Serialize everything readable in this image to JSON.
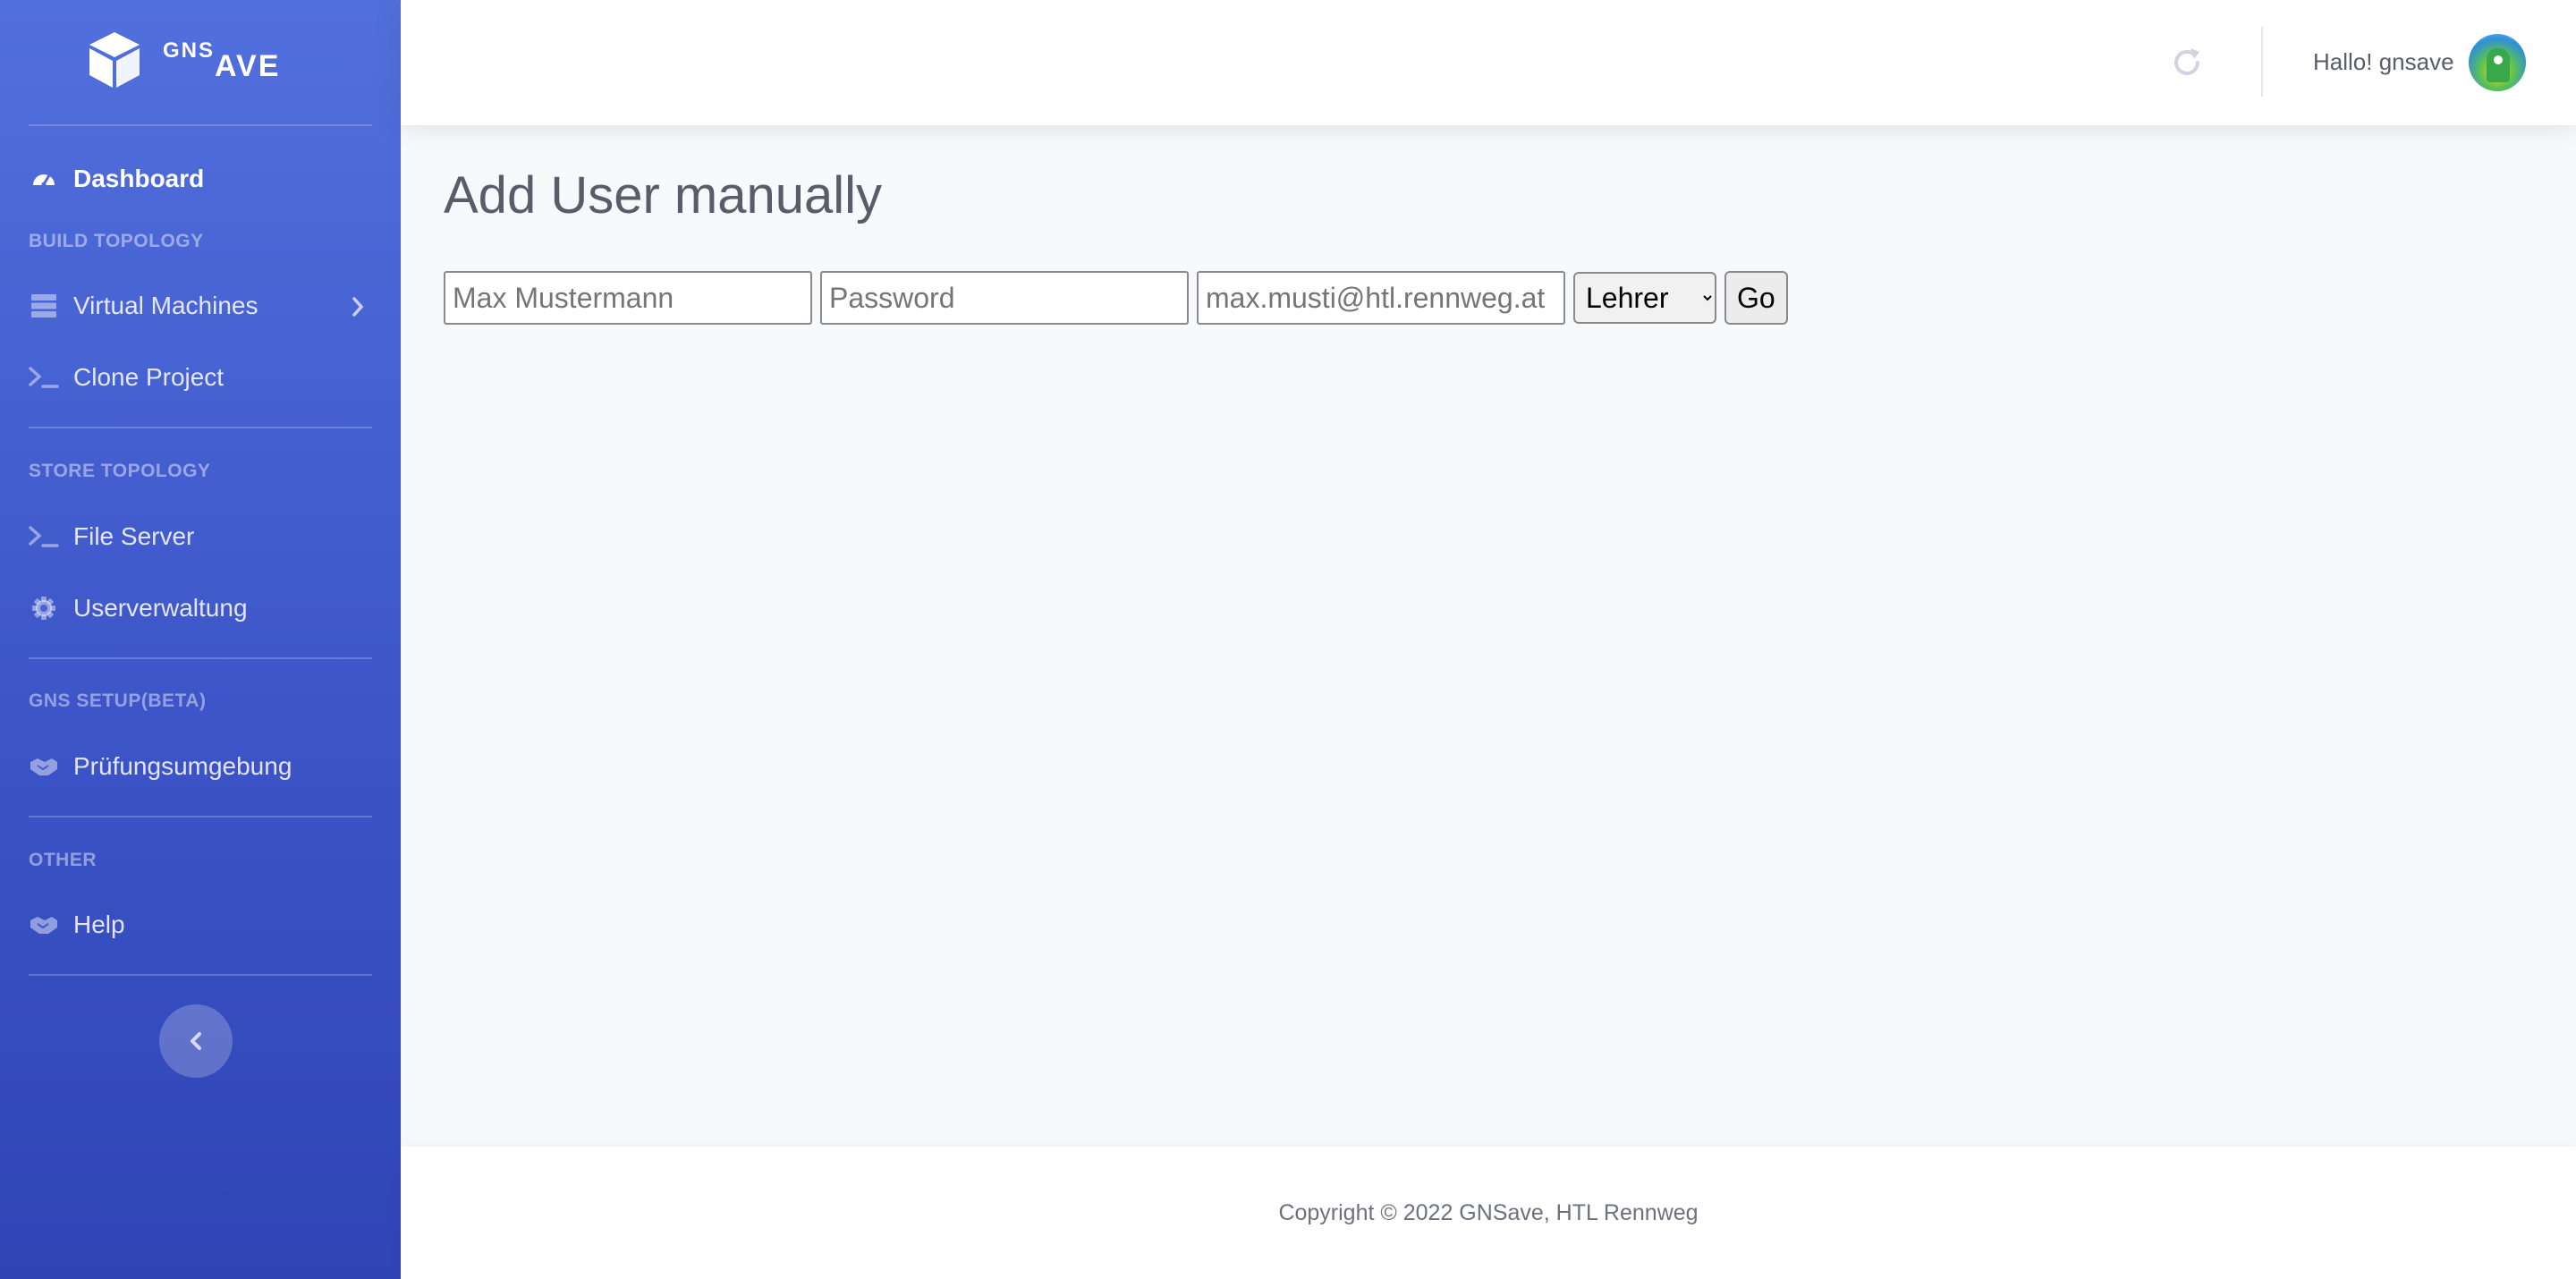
{
  "brand": {
    "part1": "GNS",
    "part2": "AVE"
  },
  "sidebar": {
    "dashboard": "Dashboard",
    "heading_build": "BUILD TOPOLOGY",
    "virtual_machines": "Virtual Machines",
    "clone_project": "Clone Project",
    "heading_store": "STORE TOPOLOGY",
    "file_server": "File Server",
    "userverwaltung": "Userverwaltung",
    "heading_gns": "GNS SETUP(BETA)",
    "pruefungsumgebung": "Prüfungsumgebung",
    "heading_other": "OTHER",
    "help": "Help"
  },
  "topbar": {
    "greeting": "Hallo! gnsave"
  },
  "main": {
    "title": "Add User manually",
    "form": {
      "name_placeholder": "Max Mustermann",
      "password_placeholder": "Password",
      "email_placeholder": "max.musti@htl.rennweg.at",
      "role_selected": "Lehrer",
      "submit_label": "Go"
    }
  },
  "footer": {
    "copyright": "Copyright © 2022 GNSave, HTL Rennweg"
  },
  "colors": {
    "sidebar_top": "#5270dd",
    "sidebar_bottom": "#2f45b6",
    "background": "#f8f9fc"
  }
}
